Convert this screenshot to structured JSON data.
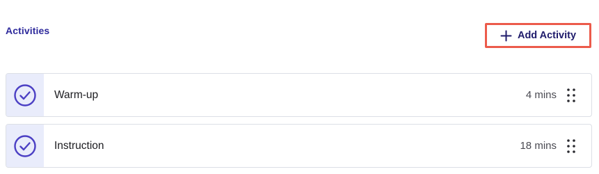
{
  "section": {
    "title": "Activities"
  },
  "add_button": {
    "label": "Add Activity",
    "icon": "plus-icon"
  },
  "colors": {
    "accent": "#2e2a9c",
    "highlight_border": "#ec5b4b",
    "status_bg": "#e9ecfb",
    "check": "#4b3fc4"
  },
  "activities": [
    {
      "name": "Warm-up",
      "duration": "4 mins",
      "status_icon": "check-circle-icon",
      "handle_icon": "drag-handle-icon"
    },
    {
      "name": "Instruction",
      "duration": "18 mins",
      "status_icon": "check-circle-icon",
      "handle_icon": "drag-handle-icon"
    }
  ]
}
